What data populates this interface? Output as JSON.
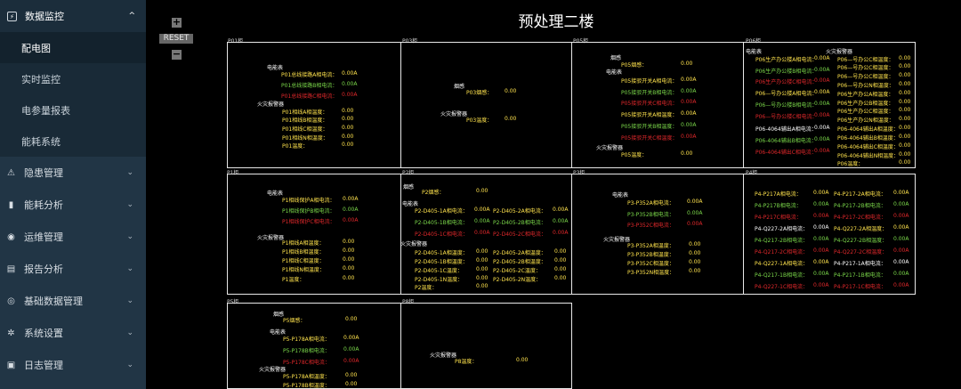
{
  "sidebar": {
    "section": {
      "label": "数据监控",
      "sub": [
        "配电图",
        "实时监控",
        "电参量报表",
        "能耗系统"
      ]
    },
    "items": [
      "隐患管理",
      "能耗分析",
      "运维管理",
      "报告分析",
      "基础数据管理",
      "系统设置",
      "日志管理"
    ]
  },
  "controls": {
    "plus": "+",
    "reset": "RESET",
    "minus": "−"
  },
  "title": "预处理二楼",
  "panels": {
    "p01": {
      "label": "P01柜",
      "power_head": "电能表",
      "currents": [
        {
          "n": "P01总线接路A相电流：",
          "v": "0.00A"
        },
        {
          "n": "P01总线接路B相电流：",
          "v": "0.00A"
        },
        {
          "n": "P01总线接路C相电流：",
          "v": "0.00A"
        }
      ],
      "fire_head": "火灾报警器",
      "temps": [
        {
          "n": "P01相线A相温度：",
          "v": "0.00"
        },
        {
          "n": "P01相线B相温度：",
          "v": "0.00"
        },
        {
          "n": "P01相线C相温度：",
          "v": "0.00"
        },
        {
          "n": "P01相线N相温度：",
          "v": "0.00"
        },
        {
          "n": "P01温度：",
          "v": "0.00"
        }
      ]
    },
    "p03": {
      "label": "P03柜",
      "smoke_head": "烟感",
      "smoke": {
        "n": "P03烟感：",
        "v": "0.00"
      },
      "fire_head": "火灾报警器",
      "temp": {
        "n": "P03温度：",
        "v": "0.00"
      }
    },
    "p05": {
      "label": "P05柜",
      "smoke_head": "烟感",
      "smoke": {
        "n": "P05烟感：",
        "v": "0.00"
      },
      "power_head": "电能表",
      "currents": [
        {
          "n": "P05接驳开关A相电流：",
          "v": "0.00A"
        },
        {
          "n": "P05接驳开关B相电流：",
          "v": "0.00A"
        },
        {
          "n": "P05接驳开关C相电流：",
          "v": "0.00A"
        },
        {
          "n": "P05接驳开关A相温度：",
          "v": "0.00A"
        },
        {
          "n": "P05接驳开关B相温度：",
          "v": "0.00A"
        },
        {
          "n": "P05接驳开关C相温度：",
          "v": "0.00A"
        }
      ],
      "fire_head": "火灾报警器",
      "temp": {
        "n": "P05温度：",
        "v": "0.00"
      }
    },
    "p06": {
      "label": "P06柜",
      "power_head": "电能表",
      "fire_head": "火灾报警器",
      "left": [
        {
          "n": "P06生产办公楼A相电流：",
          "v": "0.00A"
        },
        {
          "n": "P06生产办公楼B相电流：",
          "v": "0.00A"
        },
        {
          "n": "P06生产办公楼C相电流：",
          "v": "0.00A"
        },
        {
          "n": "P06—号办公楼A相电流：",
          "v": "0.00A"
        },
        {
          "n": "P06—号办公楼B相电流：",
          "v": "0.00A"
        },
        {
          "n": "P06—号办公楼C相电流：",
          "v": "0.00A"
        },
        {
          "n": "P06-4064辅出A相电流：",
          "v": "0.00A"
        },
        {
          "n": "P06-4064辅出B相电流：",
          "v": "0.00A"
        },
        {
          "n": "P06-4064辅出C相电流：",
          "v": "0.00A"
        }
      ],
      "right": [
        {
          "n": "P06—号办公C相温度：",
          "v": "0.00"
        },
        {
          "n": "P06—号办公C相温度：",
          "v": "0.00"
        },
        {
          "n": "P06—号办公C相温度：",
          "v": "0.00"
        },
        {
          "n": "P06—号办公N相温度：",
          "v": "0.00"
        },
        {
          "n": "P06生产办公A相温度：",
          "v": "0.00"
        },
        {
          "n": "P06生产办公B相温度：",
          "v": "0.00"
        },
        {
          "n": "P06生产办公C相温度：",
          "v": "0.00"
        },
        {
          "n": "P06生产办公N相温度：",
          "v": "0.00"
        },
        {
          "n": "P06-4064辅出A相温度：",
          "v": "0.00"
        },
        {
          "n": "P06-4064辅出B相温度：",
          "v": "0.00"
        },
        {
          "n": "P06-4064辅出C相温度：",
          "v": "0.00"
        },
        {
          "n": "P06-4064辅出N相温度：",
          "v": "0.00"
        },
        {
          "n": "P06温度：",
          "v": "0.00"
        }
      ]
    },
    "p1": {
      "label": "P1柜",
      "power_head": "电能表",
      "currents": [
        {
          "n": "P1相线保护A相电流：",
          "v": "0.00A"
        },
        {
          "n": "P1相线保护B相电流：",
          "v": "0.00A"
        },
        {
          "n": "P1相线保护C相电流：",
          "v": "0.00A"
        }
      ],
      "fire_head": "火灾报警器",
      "temps": [
        {
          "n": "P1相线A相温度：",
          "v": "0.00"
        },
        {
          "n": "P1相线B相温度：",
          "v": "0.00"
        },
        {
          "n": "P1相线C相温度：",
          "v": "0.00"
        },
        {
          "n": "P1相线N相温度：",
          "v": "0.00"
        },
        {
          "n": "P1温度：",
          "v": "0.00"
        }
      ]
    },
    "p2": {
      "label": "P2柜",
      "smoke_head": "烟感",
      "smoke": {
        "n": "P2烟感：",
        "v": "0.00"
      },
      "power_head": "电能表",
      "cur_left": [
        {
          "n": "P2-D405-1A相电流：",
          "v": "0.00A"
        },
        {
          "n": "P2-D405-1B相电流：",
          "v": "0.00A"
        },
        {
          "n": "P2-D405-1C相电流：",
          "v": "0.00A"
        }
      ],
      "cur_right": [
        {
          "n": "P2-D405-2A相电流：",
          "v": "0.00A"
        },
        {
          "n": "P2-D405-2B相电流：",
          "v": "0.00A"
        },
        {
          "n": "P2-D405-2C相电流：",
          "v": "0.00A"
        }
      ],
      "fire_head": "火灾报警器",
      "t_left": [
        {
          "n": "P2-D405-1A相温度：",
          "v": "0.00"
        },
        {
          "n": "P2-D405-1B相温度：",
          "v": "0.00"
        },
        {
          "n": "P2-D405-1C温度：",
          "v": "0.00"
        },
        {
          "n": "P2-D405-1N温度：",
          "v": "0.00"
        },
        {
          "n": "P2温度：",
          "v": "0.00"
        }
      ],
      "t_right": [
        {
          "n": "P2-D405-2A相温度：",
          "v": "0.00"
        },
        {
          "n": "P2-D405-2B相温度：",
          "v": "0.00"
        },
        {
          "n": "P2-D405-2C温度：",
          "v": "0.00"
        },
        {
          "n": "P2-D405-2N温度：",
          "v": "0.00"
        }
      ]
    },
    "p3": {
      "label": "P3柜",
      "power_head": "电能表",
      "currents": [
        {
          "n": "P3-P352A相电流：",
          "v": "0.00A"
        },
        {
          "n": "P3-P352B相电流：",
          "v": "0.00A"
        },
        {
          "n": "P3-P352C相电流：",
          "v": "0.00A"
        }
      ],
      "fire_head": "火灾报警器",
      "temps": [
        {
          "n": "P3-P352A相温度：",
          "v": "0.00"
        },
        {
          "n": "P3-P352B相温度：",
          "v": "0.00"
        },
        {
          "n": "P3-P352C相温度：",
          "v": "0.00"
        },
        {
          "n": "P3-P352N相温度：",
          "v": "0.00"
        }
      ]
    },
    "p4": {
      "label": "P4柜",
      "left": [
        {
          "n": "P4-P217A相电流：",
          "v": "0.00A"
        },
        {
          "n": "P4-P217B相电流：",
          "v": "0.00A"
        },
        {
          "n": "P4-P217C相电流：",
          "v": "0.00A"
        },
        {
          "n": "P4-Q227-2A相电流：",
          "v": "0.00A"
        },
        {
          "n": "P4-Q217-2B相电流：",
          "v": "0.00A"
        },
        {
          "n": "P4-Q217-2C相电流：",
          "v": "0.00A"
        },
        {
          "n": "P4-Q227-1A相电流：",
          "v": "0.00A"
        },
        {
          "n": "P4-Q217-1B相电流：",
          "v": "0.00A"
        },
        {
          "n": "P4-Q227-1C相电流：",
          "v": "0.00A"
        }
      ],
      "right": [
        {
          "n": "P4-P217-2A相电流：",
          "v": "0.00A"
        },
        {
          "n": "P4-P217-2B相电流：",
          "v": "0.00A"
        },
        {
          "n": "P4-P217-2C相电流：",
          "v": "0.00A"
        },
        {
          "n": "P4-Q227-2A相温度：",
          "v": "0.00A"
        },
        {
          "n": "P4-Q227-2B相温度：",
          "v": "0.00A"
        },
        {
          "n": "P4-Q227-2C相温度：",
          "v": "0.00A"
        },
        {
          "n": "P4-P217-1A相电流：",
          "v": "0.00A"
        },
        {
          "n": "P4-P217-1B相电流：",
          "v": "0.00A"
        },
        {
          "n": "P4-P217-1C相电流：",
          "v": "0.00A"
        }
      ]
    },
    "p5": {
      "label": "P5柜",
      "smoke_head": "烟感",
      "smoke": {
        "n": "P5烟感：",
        "v": "0.00"
      },
      "power_head": "电能表",
      "currents": [
        {
          "n": "P5-P178A相电流：",
          "v": "0.00A"
        },
        {
          "n": "P5-P178B相电流：",
          "v": "0.00A"
        },
        {
          "n": "P5-P178C相电流：",
          "v": "0.00A"
        }
      ],
      "fire_head": "火灾报警器",
      "temps": [
        {
          "n": "P5-P178A相温度：",
          "v": "0.00"
        },
        {
          "n": "P5-P178B相温度：",
          "v": "0.00"
        }
      ]
    },
    "p8": {
      "label": "P8柜",
      "fire_head": "火灾报警器",
      "temp": {
        "n": "P8温度：",
        "v": "0.00"
      }
    }
  }
}
